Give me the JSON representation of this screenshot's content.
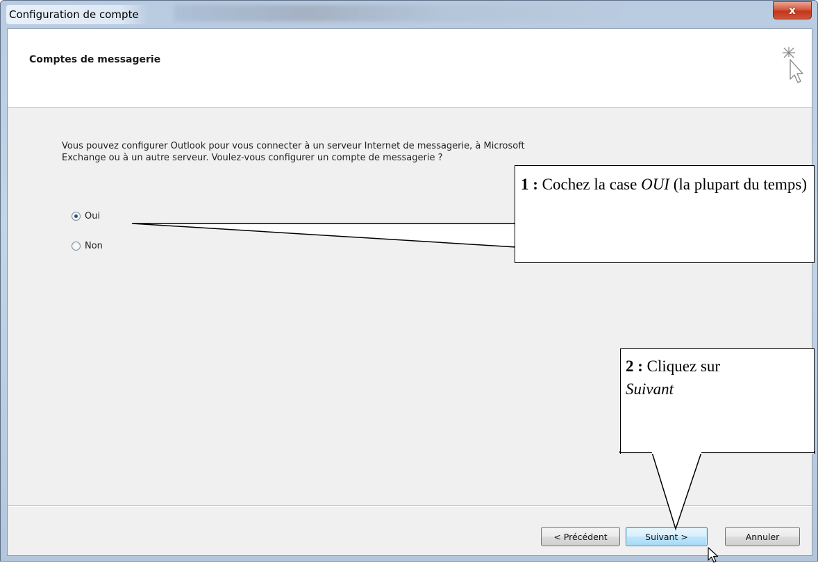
{
  "window": {
    "title": "Configuration de compte",
    "close_symbol": "x"
  },
  "header": {
    "title": "Comptes de messagerie",
    "icon": "wizard-cursor-sparkle-icon"
  },
  "content": {
    "description": "Vous pouvez configurer Outlook pour vous connecter à un serveur Internet de messagerie, à Microsoft Exchange ou à un autre serveur. Voulez-vous configurer un compte de messagerie ?",
    "radio_options": [
      {
        "label": "Oui",
        "checked": true
      },
      {
        "label": "Non",
        "checked": false
      }
    ]
  },
  "footer": {
    "buttons": {
      "back": "< Précédent",
      "next": "Suivant >",
      "cancel": "Annuler"
    }
  },
  "annotations": {
    "callout1": {
      "number": "1 :",
      "text_before": " Cochez la case ",
      "emphasis": "OUI",
      "text_after": " (la plupart du temps)"
    },
    "callout2": {
      "number": "2 :",
      "text_before": " Cliquez sur ",
      "emphasis": "Suivant"
    }
  }
}
